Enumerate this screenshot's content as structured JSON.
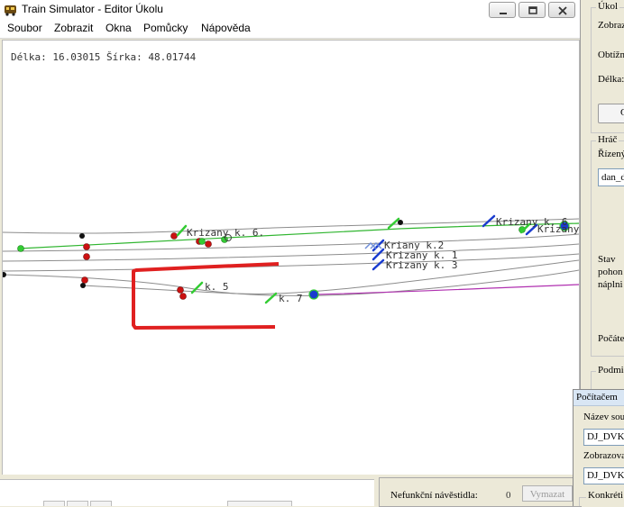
{
  "window": {
    "title": "Train Simulator - Editor Úkolu",
    "minimize_icon": "minimize-icon",
    "maximize_icon": "maximize-icon",
    "close_icon": "close-icon"
  },
  "menu": {
    "items": [
      {
        "label": "Soubor"
      },
      {
        "label": "Zobrazit"
      },
      {
        "label": "Okna"
      },
      {
        "label": "Pomůcky"
      },
      {
        "label": "Nápověda"
      }
    ]
  },
  "map": {
    "coords_text": "Délka: 16.03015 Šírka: 48.01744",
    "track_labels": {
      "k6_left": "Krizany  k. 6.",
      "k6_right": "Krizany  k. 6",
      "k6_right2": "Krizany",
      "k2": "Kriany  k.2",
      "k1": "Krizany  k. 1",
      "k3": "Krizany  k. 3",
      "k5": "k. 5",
      "k7": "k. 7"
    },
    "colors": {
      "track": "#8c8c8c",
      "active_track": "#2fb52f",
      "route_track": "#b030b0",
      "signal_red": "#cc1111",
      "signal_green": "#33cc33",
      "marker_blue": "#1a3ccf",
      "marker_green": "#33cc33",
      "annotation": "#e02020"
    }
  },
  "bottom_panel": {
    "broken_signals_label": "Nefunkční návěstidla:",
    "broken_signals_count": "0",
    "clear_button_label": "Vymazat"
  },
  "right_panel": {
    "task_group_label": "Úkol",
    "display_label": "Zobraz",
    "difficulty_label": "Obtížn",
    "length_label": "Délka:",
    "button_stub_label": "C",
    "player_group_label": "Hráč",
    "controlled_label": "Řízený",
    "controlled_value": "dan_d",
    "state_label": "Stav",
    "drive_label": "pohon",
    "fill_label": "náplni",
    "count_label": "Počáte",
    "conditions_label": "Podmi"
  },
  "dialog": {
    "title": "Počítačem",
    "source_name_label": "Název sou",
    "source_name_value": "DJ_DVK",
    "display_label": "Zobrazova",
    "display_value": "DJ_DVK",
    "concrete_label": "Konkréti"
  }
}
